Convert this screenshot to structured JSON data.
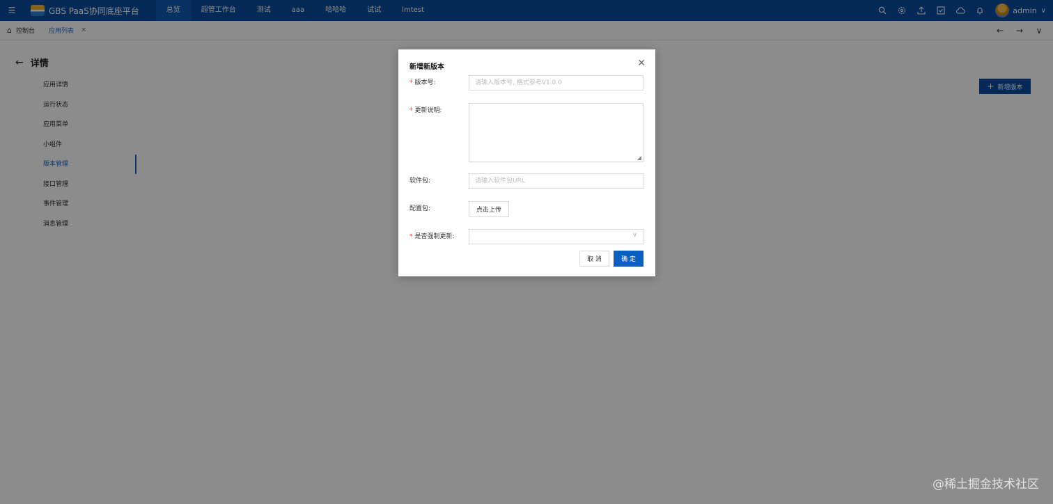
{
  "topbar": {
    "brand_title": "GBS PaaS协同底座平台",
    "nav": [
      "总览",
      "超管工作台",
      "测试",
      "aaa",
      "哈哈哈",
      "试试",
      "lmtest"
    ],
    "active_nav": 0,
    "user_name": "admin"
  },
  "tabs": {
    "home_label": "控制台",
    "app_list_label": "应用列表"
  },
  "detail": {
    "title": "详情",
    "menu": [
      "应用详情",
      "运行状态",
      "应用菜单",
      "小组件",
      "版本管理",
      "接口管理",
      "事件管理",
      "消息管理"
    ],
    "active_index": 4,
    "add_version_label": "新增版本"
  },
  "modal": {
    "title": "新增新版本",
    "version_label": "版本号:",
    "version_placeholder": "请输入版本号, 格式参考V1.0.0",
    "update_desc_label": "更新说明:",
    "package_label": "软件包:",
    "package_placeholder": "请输入软件包URL",
    "config_label": "配置包:",
    "upload_label": "点击上传",
    "force_update_label": "是否强制更新:",
    "cancel_label": "取 消",
    "ok_label": "确 定"
  },
  "watermark": "@稀土掘金技术社区",
  "colors": {
    "primary": "#0a4ea0",
    "accent": "#1f66c1",
    "required": "#e03030"
  },
  "icons": [
    "menu-icon",
    "search-icon",
    "gear-icon",
    "upload-icon",
    "checkbox-icon",
    "cloud-icon",
    "bell-icon",
    "home-icon",
    "close-icon",
    "arrow-left-icon",
    "arrow-right-icon",
    "chevron-down-icon",
    "plus-icon"
  ]
}
